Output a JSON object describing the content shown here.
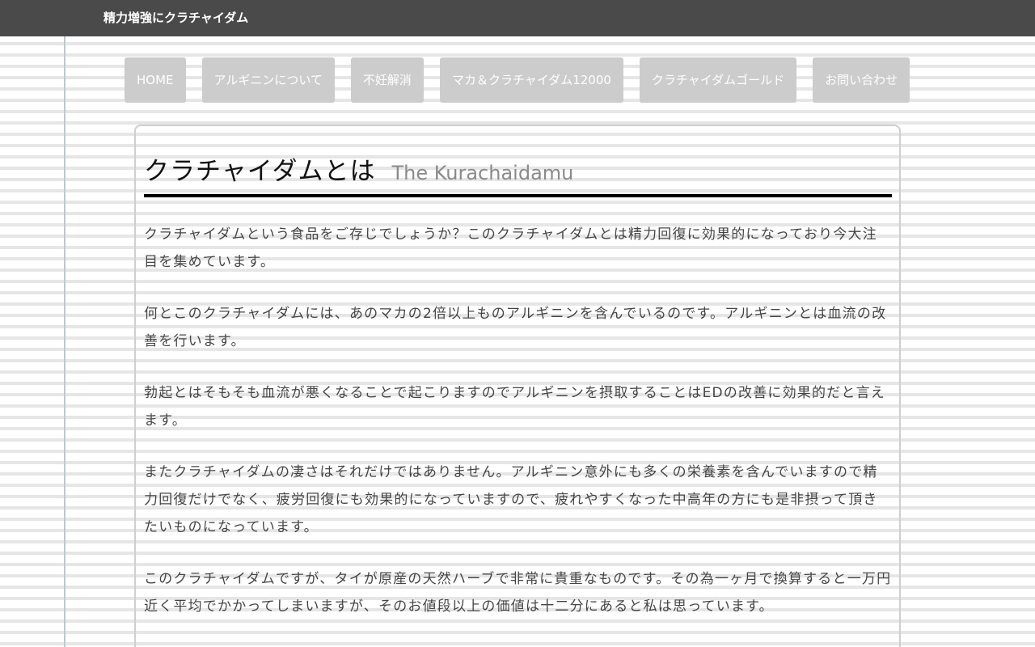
{
  "header": {
    "site_title": "精力増強にクラチャイダム"
  },
  "nav": {
    "items": [
      {
        "label": "HOME"
      },
      {
        "label": "アルギニンについて"
      },
      {
        "label": "不妊解消"
      },
      {
        "label": "マカ＆クラチャイダム12000"
      },
      {
        "label": "クラチャイダムゴールド"
      },
      {
        "label": "お問い合わせ"
      }
    ]
  },
  "article": {
    "title": "クラチャイダムとは",
    "subtitle": "The Kurachaidamu",
    "paragraphs": [
      "クラチャイダムという食品をご存じでしょうか？このクラチャイダムとは精力回復に効果的になっており今大注目を集めています。",
      "何とこのクラチャイダムには、あのマカの2倍以上ものアルギニンを含んでいるのです。アルギニンとは血流の改善を行います。",
      "勃起とはそもそも血流が悪くなることで起こりますのでアルギニンを摂取することはEDの改善に効果的だと言えます。",
      "またクラチャイダムの凄さはそれだけではありません。アルギニン意外にも多くの栄養素を含んでいますので精力回復だけでなく、疲労回復にも効果的になっていますので、疲れやすくなった中高年の方にも是非摂って頂きたいものになっています。",
      "このクラチャイダムですが、タイが原産の天然ハーブで非常に貴重なものです。その為一ヶ月で換算すると一万円近く平均でかかってしまいますが、そのお値段以上の価値は十二分にあると私は思っています。"
    ]
  },
  "colors": {
    "topbar": "#4a4a4a",
    "nav_button": "#cccccc",
    "heading_rule": "#000000",
    "body_text": "#444444"
  }
}
